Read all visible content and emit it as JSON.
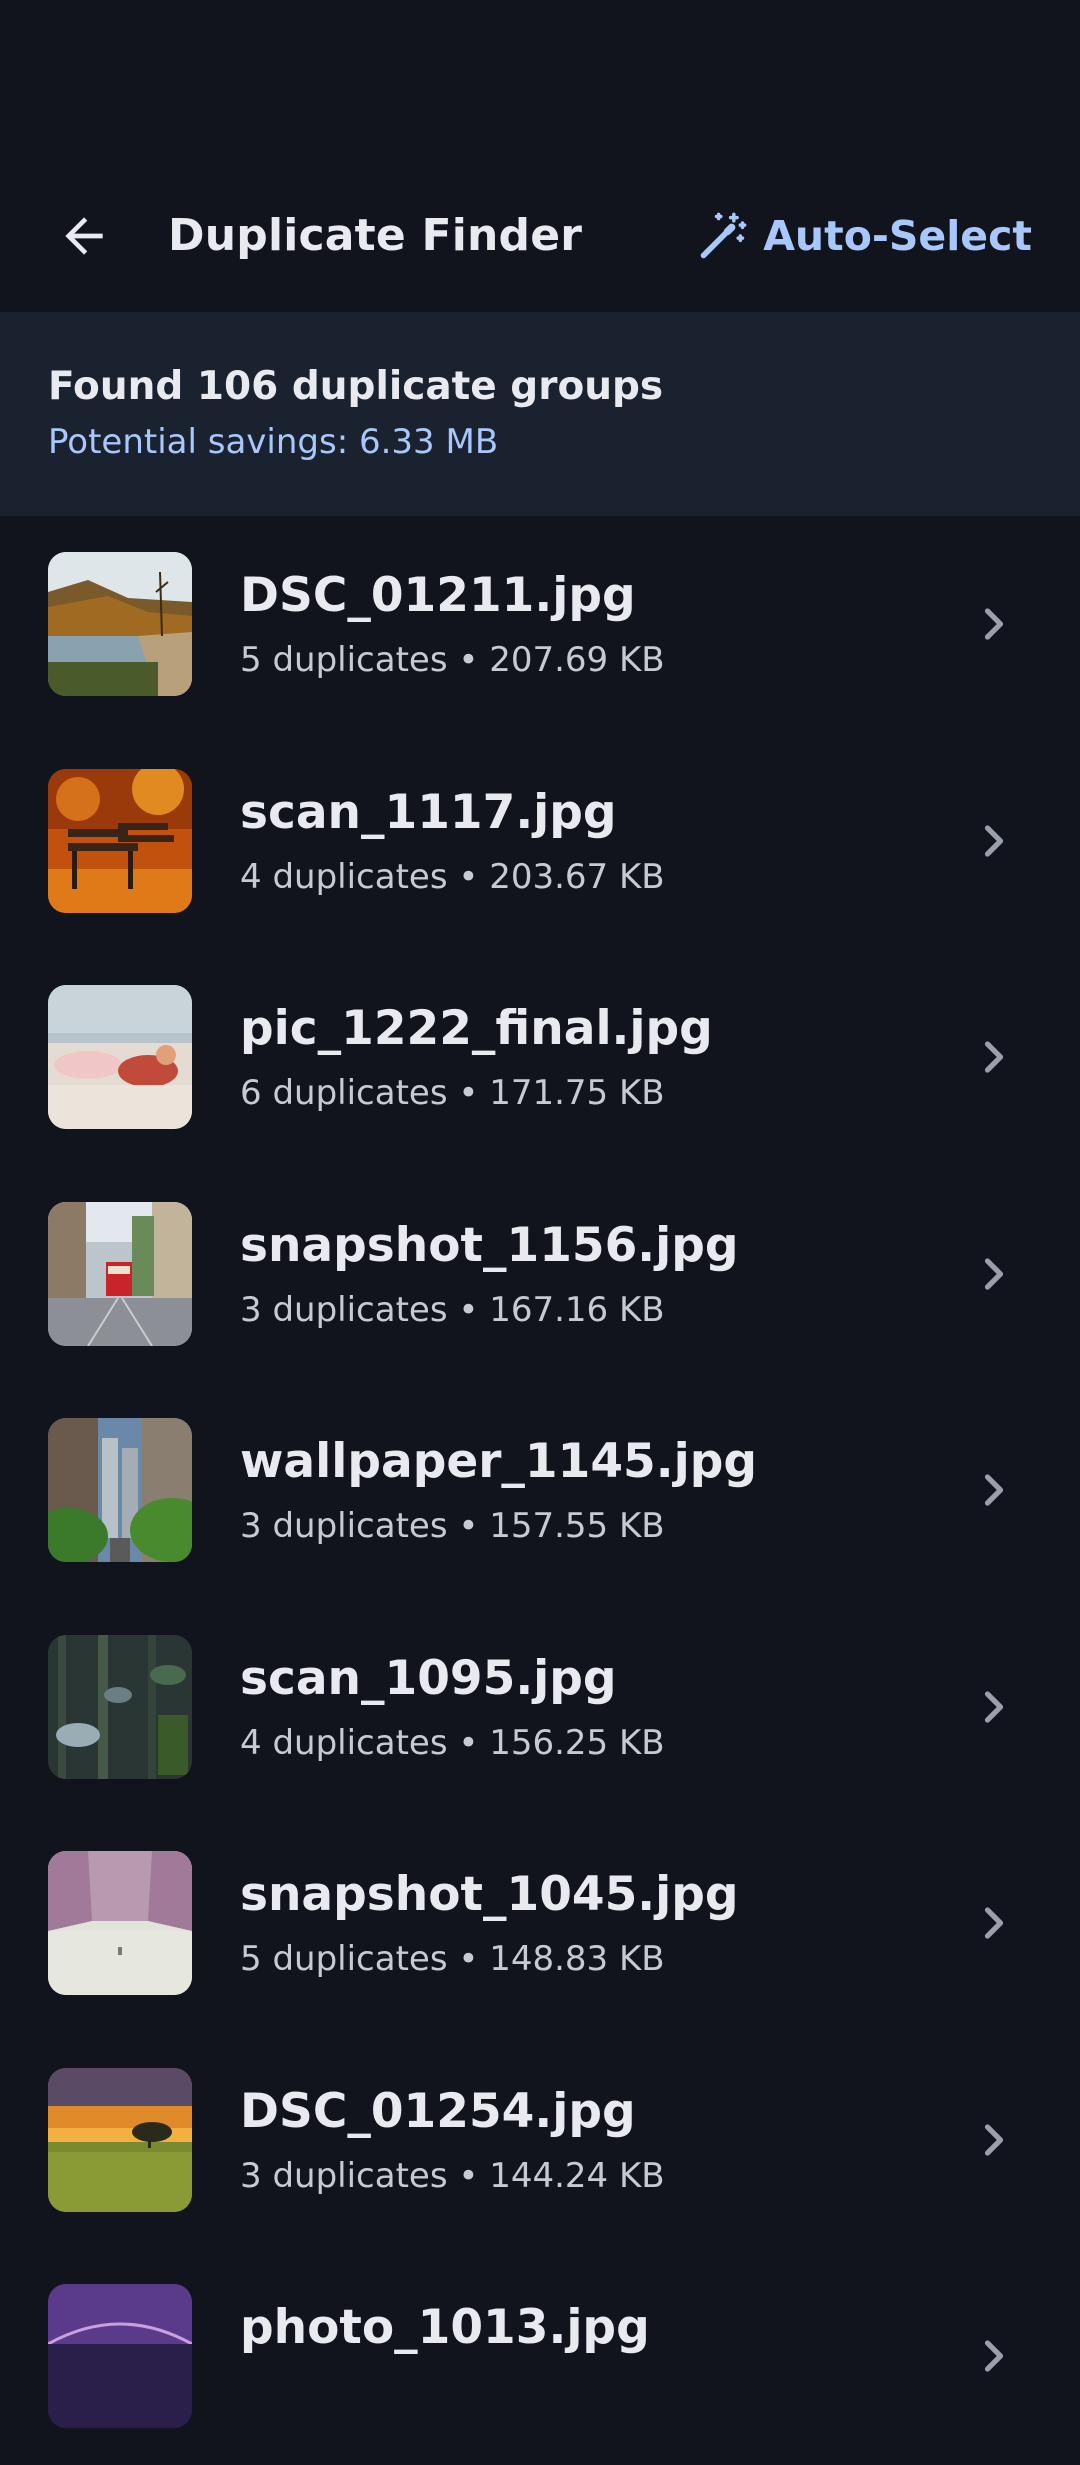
{
  "app_bar": {
    "title": "Duplicate Finder",
    "auto_select_label": "Auto-Select",
    "back_icon": "arrow-back-icon",
    "auto_select_icon": "magic-wand-icon"
  },
  "summary": {
    "title": "Found 106 duplicate groups",
    "savings": "Potential savings: 6.33 MB"
  },
  "items": [
    {
      "name": "DSC_01211.jpg",
      "meta": "5 duplicates • 207.69 KB"
    },
    {
      "name": "scan_1117.jpg",
      "meta": "4 duplicates • 203.67 KB"
    },
    {
      "name": "pic_1222_final.jpg",
      "meta": "6 duplicates • 171.75 KB"
    },
    {
      "name": "snapshot_1156.jpg",
      "meta": "3 duplicates • 167.16 KB"
    },
    {
      "name": "wallpaper_1145.jpg",
      "meta": "3 duplicates • 157.55 KB"
    },
    {
      "name": "scan_1095.jpg",
      "meta": "4 duplicates • 156.25 KB"
    },
    {
      "name": "snapshot_1045.jpg",
      "meta": "5 duplicates • 148.83 KB"
    },
    {
      "name": "DSC_01254.jpg",
      "meta": "3 duplicates • 144.24 KB"
    },
    {
      "name": "photo_1013.jpg",
      "meta": ""
    }
  ],
  "colors": {
    "background": "#11141c",
    "summary_background": "#1a2230",
    "accent": "#a8c7fa"
  }
}
